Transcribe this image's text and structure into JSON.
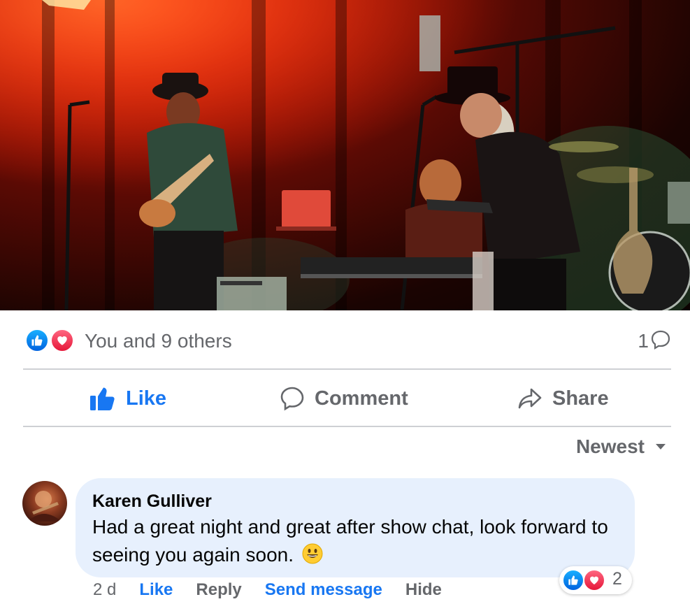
{
  "post": {
    "photo_alt": "Band performing on stage",
    "reactions": {
      "icons": [
        "like-reaction",
        "love-reaction"
      ],
      "summary": "You and 9 others",
      "comment_count": "1"
    },
    "actions": {
      "like_label": "Like",
      "comment_label": "Comment",
      "share_label": "Share"
    },
    "sort_label": "Newest"
  },
  "comments": [
    {
      "author": "Karen Gulliver",
      "text": "Had a great night and great after show chat, look forward to seeing you again soon.",
      "emoji": "grinning-face",
      "time": "2 d",
      "actions": [
        "Like",
        "Reply",
        "Send message",
        "Hide"
      ],
      "reaction_count": "2"
    }
  ],
  "colors": {
    "accent": "#1877f2",
    "secondary_text": "#65676b",
    "bubble": "#e7f0fd",
    "love": "#f33e58"
  }
}
